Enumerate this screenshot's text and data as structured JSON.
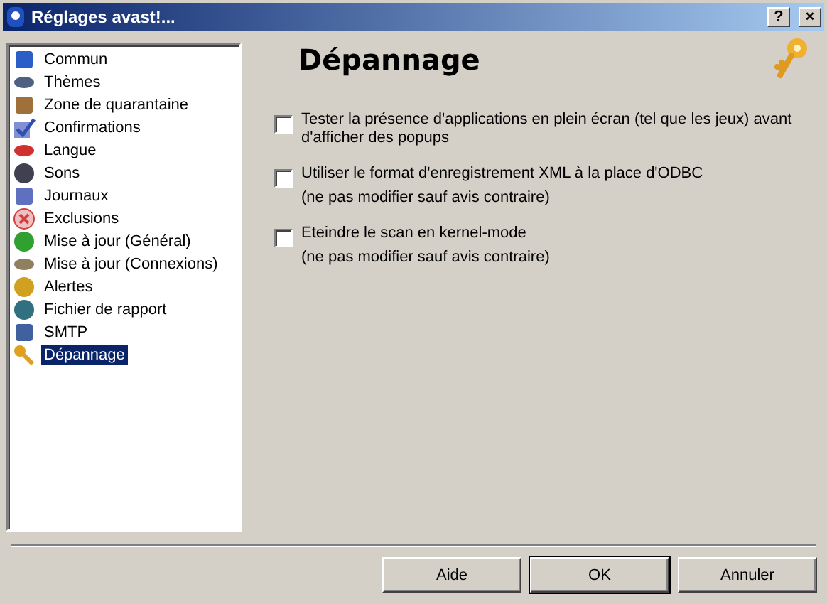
{
  "window": {
    "title": "Réglages avast!...",
    "buttons": [
      "?",
      "×"
    ]
  },
  "sidebar": {
    "items": [
      {
        "label": "Commun",
        "selected": false
      },
      {
        "label": "Thèmes",
        "selected": false
      },
      {
        "label": "Zone de quarantaine",
        "selected": false
      },
      {
        "label": "Confirmations",
        "selected": false
      },
      {
        "label": "Langue",
        "selected": false
      },
      {
        "label": "Sons",
        "selected": false
      },
      {
        "label": "Journaux",
        "selected": false
      },
      {
        "label": "Exclusions",
        "selected": false
      },
      {
        "label": "Mise à jour (Général)",
        "selected": false
      },
      {
        "label": "Mise à jour (Connexions)",
        "selected": false
      },
      {
        "label": "Alertes",
        "selected": false
      },
      {
        "label": "Fichier de rapport",
        "selected": false
      },
      {
        "label": "SMTP",
        "selected": false
      },
      {
        "label": "Dépannage",
        "selected": true
      }
    ]
  },
  "panel": {
    "title": "Dépannage",
    "options": [
      {
        "label": "Tester la présence d'applications en plein écran (tel que les jeux) avant d'afficher des popups",
        "checked": false
      },
      {
        "label": "Utiliser le format d'enregistrement XML à la place d'ODBC",
        "note": "(ne pas modifier sauf avis contraire)",
        "checked": false
      },
      {
        "label": "Eteindre le scan en kernel-mode",
        "note": "(ne pas modifier sauf avis contraire)",
        "checked": false
      }
    ]
  },
  "buttons": [
    {
      "label": "Aide",
      "default": false
    },
    {
      "label": "OK",
      "default": true
    },
    {
      "label": "Annuler",
      "default": false
    }
  ]
}
